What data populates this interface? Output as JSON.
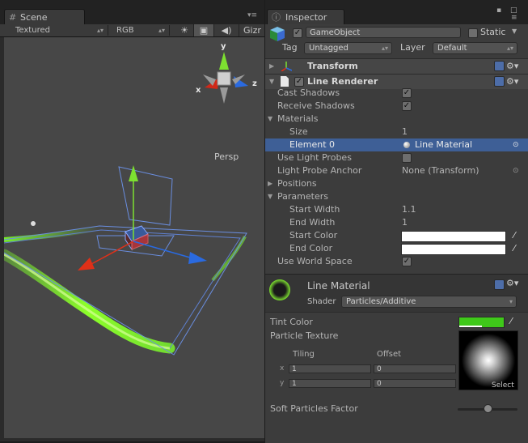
{
  "scene": {
    "tab_label": "Scene",
    "tab_icon": "grid-icon",
    "toolbar": {
      "render_mode": "Textured",
      "channel": "RGB",
      "gizmos_label": "Gizr"
    },
    "persp_label": "Persp",
    "axes": {
      "x": "x",
      "y": "y",
      "z": "z"
    }
  },
  "inspector": {
    "tab_label": "Inspector",
    "object_name": "GameObject",
    "static_label": "Static",
    "tag_label": "Tag",
    "tag_value": "Untagged",
    "layer_label": "Layer",
    "layer_value": "Default",
    "components": {
      "transform": {
        "title": "Transform"
      },
      "line_renderer": {
        "title": "Line Renderer",
        "props": {
          "cast_shadows": "Cast Shadows",
          "receive_shadows": "Receive Shadows",
          "materials": "Materials",
          "size_label": "Size",
          "size_value": "1",
          "element0_label": "Element 0",
          "element0_value": "Line Material",
          "use_light_probes": "Use Light Probes",
          "light_probe_anchor": "Light Probe Anchor",
          "light_probe_anchor_value": "None (Transform)",
          "positions": "Positions",
          "parameters": "Parameters",
          "start_width_label": "Start Width",
          "start_width_value": "1.1",
          "end_width_label": "End Width",
          "end_width_value": "1",
          "start_color_label": "Start Color",
          "end_color_label": "End Color",
          "use_world_space": "Use World Space"
        }
      }
    },
    "material": {
      "name": "Line Material",
      "shader_label": "Shader",
      "shader_value": "Particles/Additive",
      "tint_color_label": "Tint Color",
      "tint_color": "#3fc81a",
      "particle_texture_label": "Particle Texture",
      "tiling_label": "Tiling",
      "offset_label": "Offset",
      "x_label": "x",
      "y_label": "y",
      "tiling_x": "1",
      "tiling_y": "1",
      "offset_x": "0",
      "offset_y": "0",
      "select_label": "Select",
      "soft_particles_label": "Soft Particles Factor",
      "soft_particles_value": 0.5
    }
  },
  "colors": {
    "selection": "#3e5f96",
    "line_green": "#7dff2a",
    "axis_x": "#e03018",
    "axis_y": "#7de030",
    "axis_z": "#2a6ae0"
  }
}
